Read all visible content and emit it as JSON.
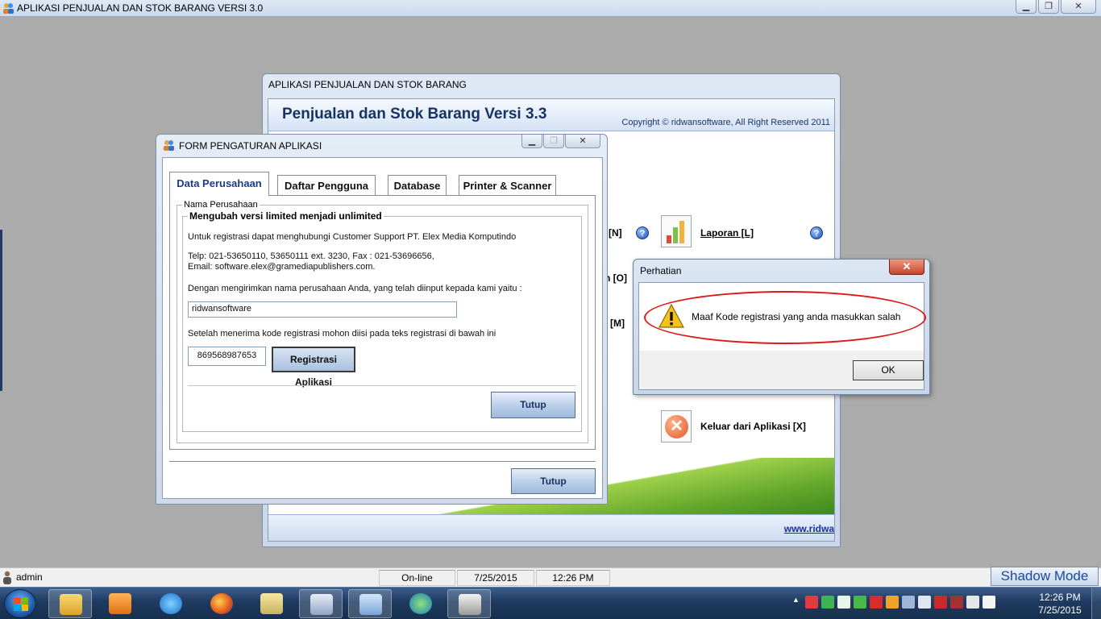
{
  "app": {
    "title": "APLIKASI PENJUALAN DAN STOK BARANG VERSI 3.0",
    "win_minimize": "▁",
    "win_maximize": "❐",
    "win_close": "✕"
  },
  "main_window": {
    "title": "APLIKASI PENJUALAN DAN STOK BARANG",
    "heading": "Penjualan dan Stok Barang Versi 3.3",
    "copyright": "Copyright © ridwansoftware, All Right Reserved 2011",
    "items": {
      "partial_n": "[N]",
      "partial_o": "n [O]",
      "partial_m": "[M]",
      "laporan": "Laporan [L]",
      "keluar": "Keluar dari Aplikasi [X]"
    },
    "help_glyph": "?",
    "exit_glyph": "✕",
    "footer_link": "www.ridwa"
  },
  "settings_form": {
    "title": "FORM PENGATURAN APLIKASI",
    "tabs": [
      "Data Perusahaan",
      "Daftar Pengguna",
      "Database",
      "Printer & Scanner"
    ],
    "group_outer_label": "Nama Perusahaan",
    "group_inner_label": "Mengubah versi limited menjadi unlimited",
    "text_contact": "Untuk registrasi dapat menghubungi Customer Support PT. Elex Media Komputindo",
    "text_phone": "Telp: 021-53650110, 53650111 ext. 3230, Fax : 021-53696656,",
    "text_email": "Email: software.elex@gramediapublishers.com.",
    "text_send": "Dengan mengirimkan nama perusahaan Anda, yang telah diinput kepada kami yaitu :",
    "company_name": "ridwansoftware",
    "text_after": "Setelah menerima kode registrasi mohon diisi pada teks registrasi di bawah ini",
    "registration_code": "869568987653",
    "register_button": "Registrasi Aplikasi",
    "inner_close_button": "Tutup",
    "outer_close_button": "Tutup"
  },
  "message_box": {
    "title": "Perhatian",
    "message": "Maaf Kode registrasi yang anda masukkan salah",
    "ok_button": "OK",
    "close_glyph": "✕"
  },
  "status_bar": {
    "user": "admin",
    "connection": "On-line",
    "date": "7/25/2015",
    "time": "12:26 PM",
    "shadow_mode": "Shadow Mode"
  },
  "taskbar": {
    "clock_time": "12:26 PM",
    "clock_date": "7/25/2015",
    "tray_arrow": "▲"
  },
  "colors": {
    "accent_blue": "#17335f",
    "alert_red": "#dd1a1a",
    "warning_yellow": "#f3c31c",
    "taskbar": "#1f3a60"
  },
  "icons": [
    "app-people-icon",
    "help-icon",
    "report-chart-icon",
    "exit-icon",
    "warning-icon",
    "user-icon",
    "windows-start-icon"
  ]
}
